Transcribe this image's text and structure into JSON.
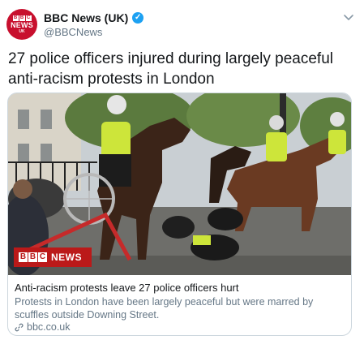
{
  "account": {
    "display_name": "BBC News (UK)",
    "handle": "@BBCNews",
    "verified": true,
    "avatar": {
      "blocks": [
        "B",
        "B",
        "C"
      ],
      "word": "NEWS",
      "region": "UK"
    }
  },
  "tweet": {
    "text": "27 police officers injured during largely peaceful anti-racism protests in London"
  },
  "card": {
    "badge": {
      "blocks": [
        "B",
        "B",
        "C"
      ],
      "word": "NEWS"
    },
    "title": "Anti-racism protests leave 27 police officers hurt",
    "description": "Protests in London have been largely peaceful but were marred by scuffles outside Downing Street.",
    "domain": "bbc.co.uk"
  },
  "icons": {
    "menu": "chevron-down-icon",
    "verified": "verified-badge-icon",
    "link": "link-icon"
  },
  "colors": {
    "bbc_red": "#bb1919",
    "avatar_red": "#c8102e",
    "twitter_blue": "#1da1f2",
    "secondary_text": "#657786"
  }
}
